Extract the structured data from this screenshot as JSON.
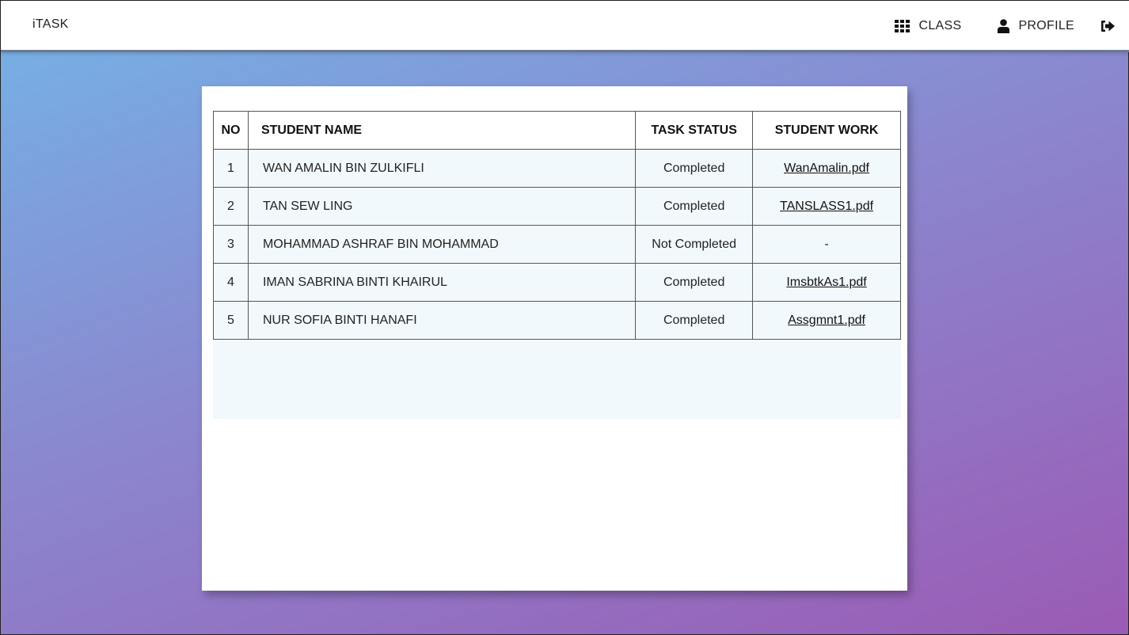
{
  "header": {
    "brand": "iTASK",
    "nav": {
      "class_label": "CLASS",
      "profile_label": "PROFILE"
    },
    "icons": {
      "class": "grid-icon",
      "profile": "user-icon",
      "logout": "sign-out-icon"
    }
  },
  "table": {
    "columns": {
      "no": "NO",
      "name": "STUDENT NAME",
      "status": "TASK STATUS",
      "work": "STUDENT WORK"
    },
    "rows": [
      {
        "no": "1",
        "name": "WAN AMALIN BIN ZULKIFLI",
        "status": "Completed",
        "work": "WanAmalin.pdf",
        "work_is_link": true
      },
      {
        "no": "2",
        "name": "TAN SEW LING",
        "status": "Completed",
        "work": "TANSLASS1.pdf",
        "work_is_link": true
      },
      {
        "no": "3",
        "name": "MOHAMMAD ASHRAF BIN MOHAMMAD",
        "status": "Not Completed",
        "work": "-",
        "work_is_link": false
      },
      {
        "no": "4",
        "name": "IMAN SABRINA BINTI KHAIRUL",
        "status": "Completed",
        "work": "ImsbtkAs1.pdf",
        "work_is_link": true
      },
      {
        "no": "5",
        "name": "NUR SOFIA BINTI HANAFI",
        "status": "Completed",
        "work": "Assgmnt1.pdf",
        "work_is_link": true
      }
    ]
  },
  "colors": {
    "gradient_start": "#74b3e6",
    "gradient_end": "#9b5bb5",
    "table_row_bg": "#f2f9fd"
  }
}
